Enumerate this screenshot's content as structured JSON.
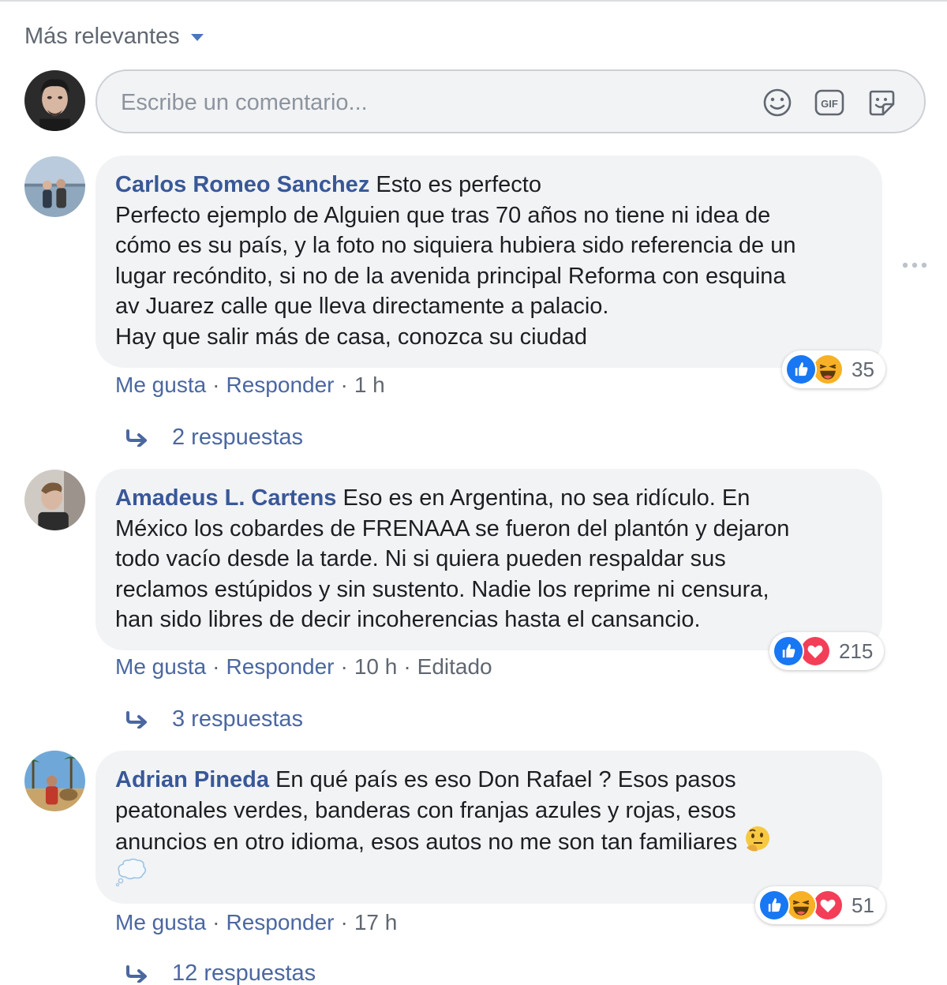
{
  "sort": {
    "label": "Más relevantes"
  },
  "composer": {
    "placeholder": "Escribe un comentario...",
    "icons": [
      "emoji-icon",
      "gif-icon",
      "sticker-icon"
    ]
  },
  "comments": [
    {
      "author": "Carlos Romeo Sanchez",
      "lines": [
        "Esto es perfecto",
        "Perfecto ejemplo de Alguien que tras 70 años no tiene ni idea de",
        "cómo es su país, y la foto no siquiera hubiera sido referencia de un",
        "lugar recóndito, si no de la avenida principal Reforma con esquina",
        "av Juarez calle que lleva directamente a palacio.",
        "Hay que salir más de casa, conozca su ciudad"
      ],
      "reactions": [
        "like",
        "haha"
      ],
      "reaction_count": "35",
      "actions": {
        "like": "Me gusta",
        "reply": "Responder",
        "time": "1 h"
      },
      "replies_label": "2 respuestas"
    },
    {
      "author": "Amadeus L. Cartens",
      "lines": [
        "Eso es en Argentina, no sea ridículo. En",
        "México los cobardes de FRENAAA se fueron del plantón y dejaron",
        "todo vacío desde la tarde. Ni si quiera pueden respaldar sus",
        "reclamos estúpidos y sin sustento. Nadie los reprime ni censura,",
        "han sido libres de decir incoherencias hasta el cansancio."
      ],
      "reactions": [
        "like",
        "love"
      ],
      "reaction_count": "215",
      "actions": {
        "like": "Me gusta",
        "reply": "Responder",
        "time": "10 h",
        "edited": "Editado"
      },
      "replies_label": "3 respuestas"
    },
    {
      "author": "Adrian Pineda",
      "lines": [
        "En qué país es eso Don Rafael ? Esos pasos",
        "peatonales verdes, banderas con franjas azules y rojas, esos",
        "anuncios en otro idioma, esos autos no me son tan familiares"
      ],
      "trailing_emojis": [
        "thinking-face-emoji",
        "thought-balloon-emoji"
      ],
      "reactions": [
        "like",
        "haha",
        "love"
      ],
      "reaction_count": "51",
      "actions": {
        "like": "Me gusta",
        "reply": "Responder",
        "time": "17 h"
      },
      "replies_label": "12 respuestas"
    }
  ],
  "colors": {
    "link": "#385898",
    "action": "#4b67a1",
    "meta": "#606770",
    "bubble": "#f2f3f5",
    "like": "#1877f2",
    "love": "#f33e58",
    "haha": "#f7b125"
  }
}
